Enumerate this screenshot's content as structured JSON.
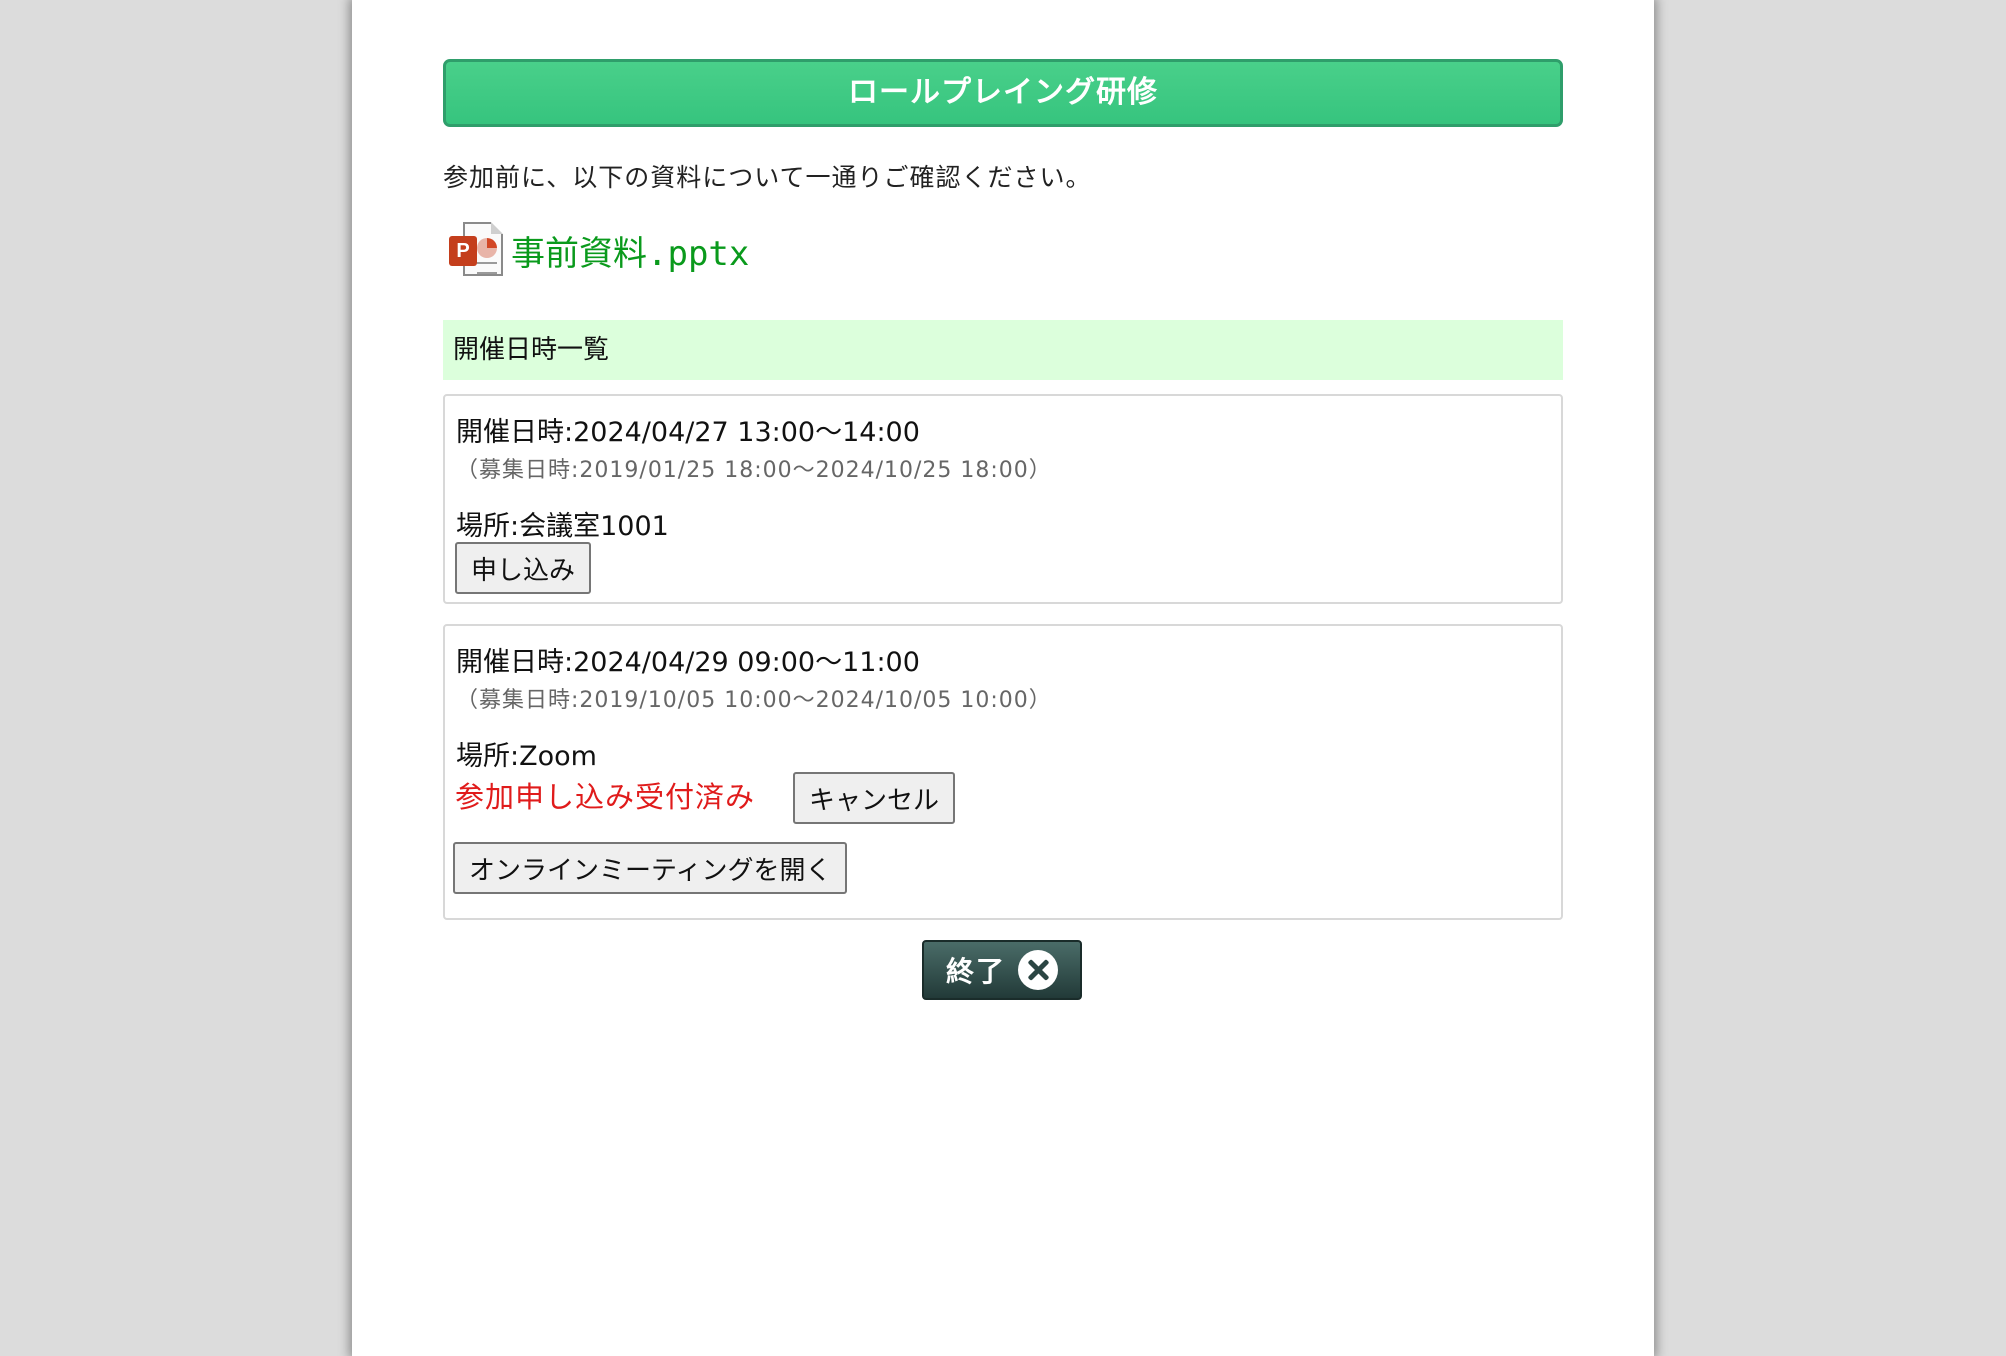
{
  "header": {
    "title": "ロールプレイング研修"
  },
  "instruction": "参加前に、以下の資料について一通りご確認ください。",
  "material": {
    "icon_badge": "P",
    "filename": "事前資料.pptx"
  },
  "schedule": {
    "heading": "開催日時一覧",
    "sessions": [
      {
        "date": "開催日時:2024/04/27 13:00～14:00",
        "recruit_period": "（募集日時:2019/01/25 18:00～2024/10/25 18:00）",
        "place": "場所:会議室1001",
        "apply_label": "申し込み"
      },
      {
        "date": "開催日時:2024/04/29 09:00～11:00",
        "recruit_period": "（募集日時:2019/10/05 10:00～2024/10/05 10:00）",
        "place": "場所:Zoom",
        "status": "参加申し込み受付済み",
        "cancel_label": "キャンセル",
        "open_meeting_label": "オンラインミーティングを開く"
      }
    ]
  },
  "footer": {
    "end_label": "終了"
  }
}
